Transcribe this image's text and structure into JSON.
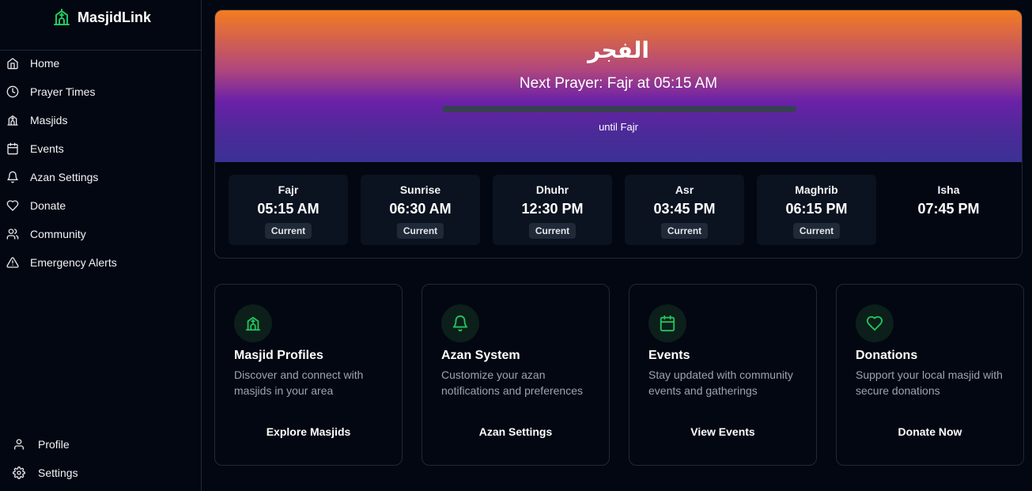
{
  "app": {
    "name": "MasjidLink",
    "accent": "#22c55e"
  },
  "sidebar": {
    "items": [
      {
        "label": "Home",
        "icon": "home-icon"
      },
      {
        "label": "Prayer Times",
        "icon": "clock-icon"
      },
      {
        "label": "Masjids",
        "icon": "mosque-icon"
      },
      {
        "label": "Events",
        "icon": "calendar-icon"
      },
      {
        "label": "Azan Settings",
        "icon": "bell-icon"
      },
      {
        "label": "Donate",
        "icon": "heart-icon"
      },
      {
        "label": "Community",
        "icon": "users-icon"
      },
      {
        "label": "Emergency Alerts",
        "icon": "alert-triangle-icon"
      }
    ],
    "bottom": [
      {
        "label": "Profile",
        "icon": "user-icon"
      },
      {
        "label": "Settings",
        "icon": "gear-icon"
      }
    ]
  },
  "hero": {
    "arabic": "الفجر",
    "next_prayer": "Next Prayer: Fajr at 05:15 AM",
    "progress": 0,
    "until": "until Fajr"
  },
  "prayers": [
    {
      "name": "Fajr",
      "time": "05:15 AM",
      "badge": "Current"
    },
    {
      "name": "Sunrise",
      "time": "06:30 AM",
      "badge": "Current"
    },
    {
      "name": "Dhuhr",
      "time": "12:30 PM",
      "badge": "Current"
    },
    {
      "name": "Asr",
      "time": "03:45 PM",
      "badge": "Current"
    },
    {
      "name": "Maghrib",
      "time": "06:15 PM",
      "badge": "Current"
    },
    {
      "name": "Isha",
      "time": "07:45 PM",
      "badge": ""
    }
  ],
  "features": [
    {
      "title": "Masjid Profiles",
      "desc": "Discover and connect with masjids in your area",
      "link": "Explore Masjids",
      "icon": "mosque-icon"
    },
    {
      "title": "Azan System",
      "desc": "Customize your azan notifications and preferences",
      "link": "Azan Settings",
      "icon": "bell-icon"
    },
    {
      "title": "Events",
      "desc": "Stay updated with community events and gatherings",
      "link": "View Events",
      "icon": "calendar-icon"
    },
    {
      "title": "Donations",
      "desc": "Support your local masjid with secure donations",
      "link": "Donate Now",
      "icon": "heart-icon"
    }
  ]
}
